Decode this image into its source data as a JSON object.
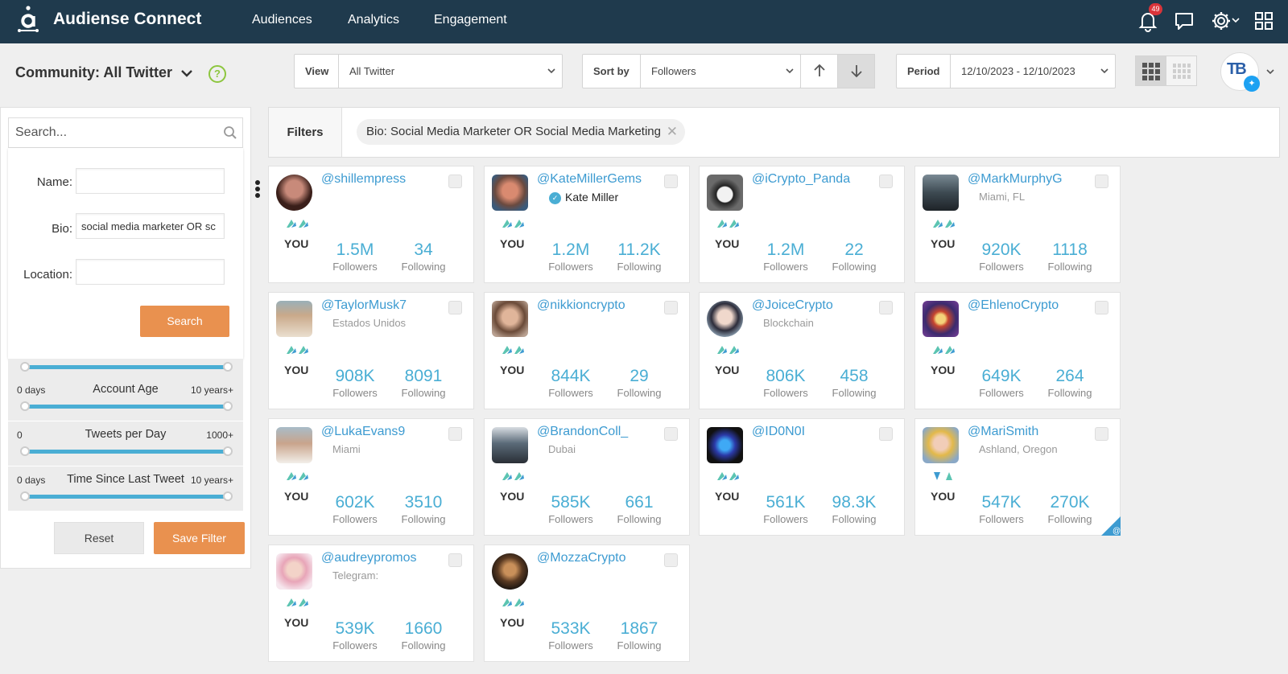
{
  "app": {
    "title": "Audiense Connect",
    "notifications_count": "49"
  },
  "nav": [
    {
      "label": "Audiences"
    },
    {
      "label": "Analytics"
    },
    {
      "label": "Engagement"
    }
  ],
  "toolbar": {
    "community_title": "Community: All Twitter",
    "help": "?",
    "view_label": "View",
    "view_value": "All Twitter",
    "sort_label": "Sort by",
    "sort_value": "Followers",
    "period_label": "Period",
    "period_value": "12/10/2023 - 12/10/2023",
    "account_initials": "TB"
  },
  "sidebar": {
    "search_placeholder": "Search...",
    "name_label": "Name:",
    "name_value": "",
    "bio_label": "Bio:",
    "bio_value": "social media marketer OR sc",
    "location_label": "Location:",
    "location_value": "",
    "search_button": "Search",
    "ranges": [
      {
        "min": "0 days",
        "name": "Account Age",
        "max": "10 years+"
      },
      {
        "min": "0",
        "name": "Tweets per Day",
        "max": "1000+"
      },
      {
        "min": "0 days",
        "name": "Time Since Last Tweet",
        "max": "10 years+"
      }
    ],
    "reset_button": "Reset",
    "save_button": "Save Filter"
  },
  "filters": {
    "label": "Filters",
    "chips": [
      {
        "text": "Bio: Social Media Marketer OR Social Media Marketing"
      }
    ]
  },
  "common": {
    "you": "YOU",
    "followers_label": "Followers",
    "following_label": "Following"
  },
  "colors": {
    "nav_bg": "#1f3a4d",
    "accent_blue": "#4aaed4",
    "link_blue": "#3d9bd1",
    "orange": "#e9914f",
    "follow_arrows_green": "#5cc4b2",
    "follow_arrows_blue": "#3d9bd1"
  },
  "cards": [
    {
      "handle": "@shillempress",
      "subtitle": "",
      "followers": "1.5M",
      "following": "34"
    },
    {
      "handle": "@KateMillerGems",
      "subtitle": "",
      "verified_name": "Kate Miller",
      "followers": "1.2M",
      "following": "11.2K"
    },
    {
      "handle": "@iCrypto_Panda",
      "subtitle": "",
      "followers": "1.2M",
      "following": "22"
    },
    {
      "handle": "@MarkMurphyG",
      "subtitle": "Miami, FL",
      "followers": "920K",
      "following": "1118"
    },
    {
      "handle": "@TaylorMusk7",
      "subtitle": "Estados Unidos",
      "followers": "908K",
      "following": "8091"
    },
    {
      "handle": "@nikkioncrypto",
      "subtitle": "",
      "followers": "844K",
      "following": "29"
    },
    {
      "handle": "@JoiceCrypto",
      "subtitle": "Blockchain",
      "followers": "806K",
      "following": "458"
    },
    {
      "handle": "@EhlenoCrypto",
      "subtitle": "",
      "followers": "649K",
      "following": "264"
    },
    {
      "handle": "@LukaEvans9",
      "subtitle": "Miami",
      "followers": "602K",
      "following": "3510"
    },
    {
      "handle": "@BrandonColl_",
      "subtitle": "Dubai",
      "followers": "585K",
      "following": "661"
    },
    {
      "handle": "@ID0N0I",
      "subtitle": "",
      "followers": "561K",
      "following": "98.3K"
    },
    {
      "handle": "@MariSmith",
      "subtitle": "Ashland, Oregon",
      "followers": "547K",
      "following": "270K"
    },
    {
      "handle": "@audreypromos",
      "subtitle": "Telegram:",
      "followers": "539K",
      "following": "1660"
    },
    {
      "handle": "@MozzaCrypto",
      "subtitle": "",
      "followers": "533K",
      "following": "1867"
    }
  ]
}
